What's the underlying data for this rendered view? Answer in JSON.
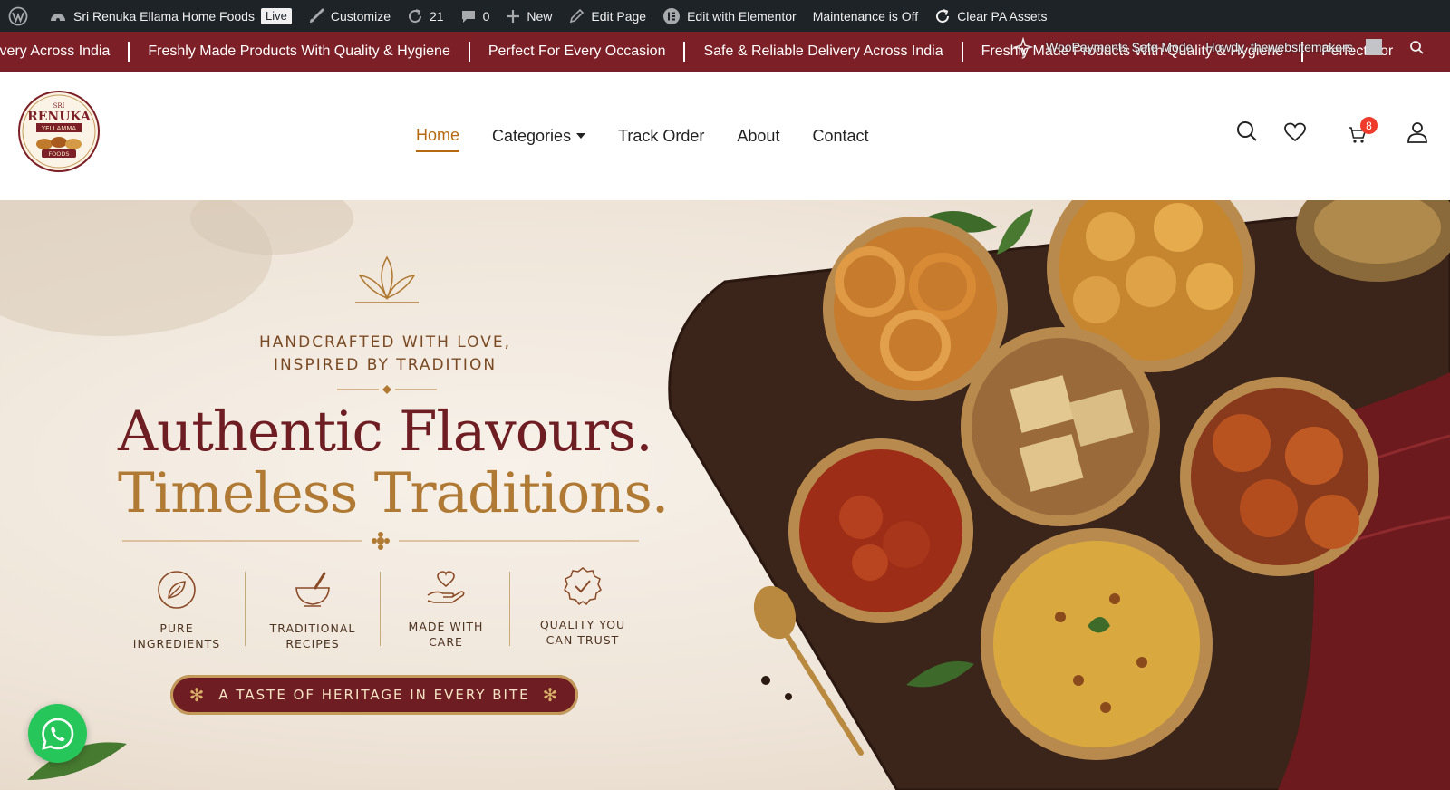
{
  "adminbar": {
    "site_name": "Sri Renuka Ellama Home Foods",
    "live_badge": "Live",
    "customize": "Customize",
    "updates_count": "21",
    "comments_count": "0",
    "new": "New",
    "edit_page": "Edit Page",
    "edit_elementor": "Edit with Elementor",
    "maintenance": "Maintenance is Off",
    "clear_assets": "Clear PA Assets",
    "woopayments": "WooPayments Safe Mode",
    "howdy": "Howdy, thewebsitemakers"
  },
  "marquee": {
    "items": [
      "ivery Across India",
      "Freshly Made Products With Quality & Hygiene",
      "Perfect For Every Occasion",
      "Safe & Reliable Delivery Across India",
      "Freshly Made Products With Quality & Hygiene",
      "Perfect For"
    ]
  },
  "header": {
    "logo": {
      "top": "SRI",
      "main": "RENUKA",
      "sub": "YELLAMMA",
      "foods": "FOODS"
    },
    "nav": [
      {
        "label": "Home",
        "active": true
      },
      {
        "label": "Categories",
        "dropdown": true
      },
      {
        "label": "Track Order"
      },
      {
        "label": "About"
      },
      {
        "label": "Contact"
      }
    ],
    "cart_count": "8"
  },
  "hero": {
    "tagline_line1": "HANDCRAFTED WITH LOVE,",
    "tagline_line2": "INSPIRED BY TRADITION",
    "headline_line1": "Authentic Flavours.",
    "headline_line2": "Timeless Traditions.",
    "features": [
      {
        "line1": "PURE",
        "line2": "INGREDIENTS",
        "icon": "leaf-icon"
      },
      {
        "line1": "TRADITIONAL",
        "line2": "RECIPES",
        "icon": "mortar-pestle-icon"
      },
      {
        "line1": "MADE WITH",
        "line2": "CARE",
        "icon": "heart-hand-icon"
      },
      {
        "line1": "QUALITY YOU",
        "line2": "CAN TRUST",
        "icon": "quality-badge-icon"
      }
    ],
    "banner": "A TASTE OF HERITAGE IN EVERY BITE"
  },
  "colors": {
    "adminbar": "#1d2327",
    "marquee": "#7c1f26",
    "accent": "#b56a12",
    "maroon": "#6e1d22",
    "gold": "#b07a34",
    "whatsapp": "#27c65a"
  }
}
